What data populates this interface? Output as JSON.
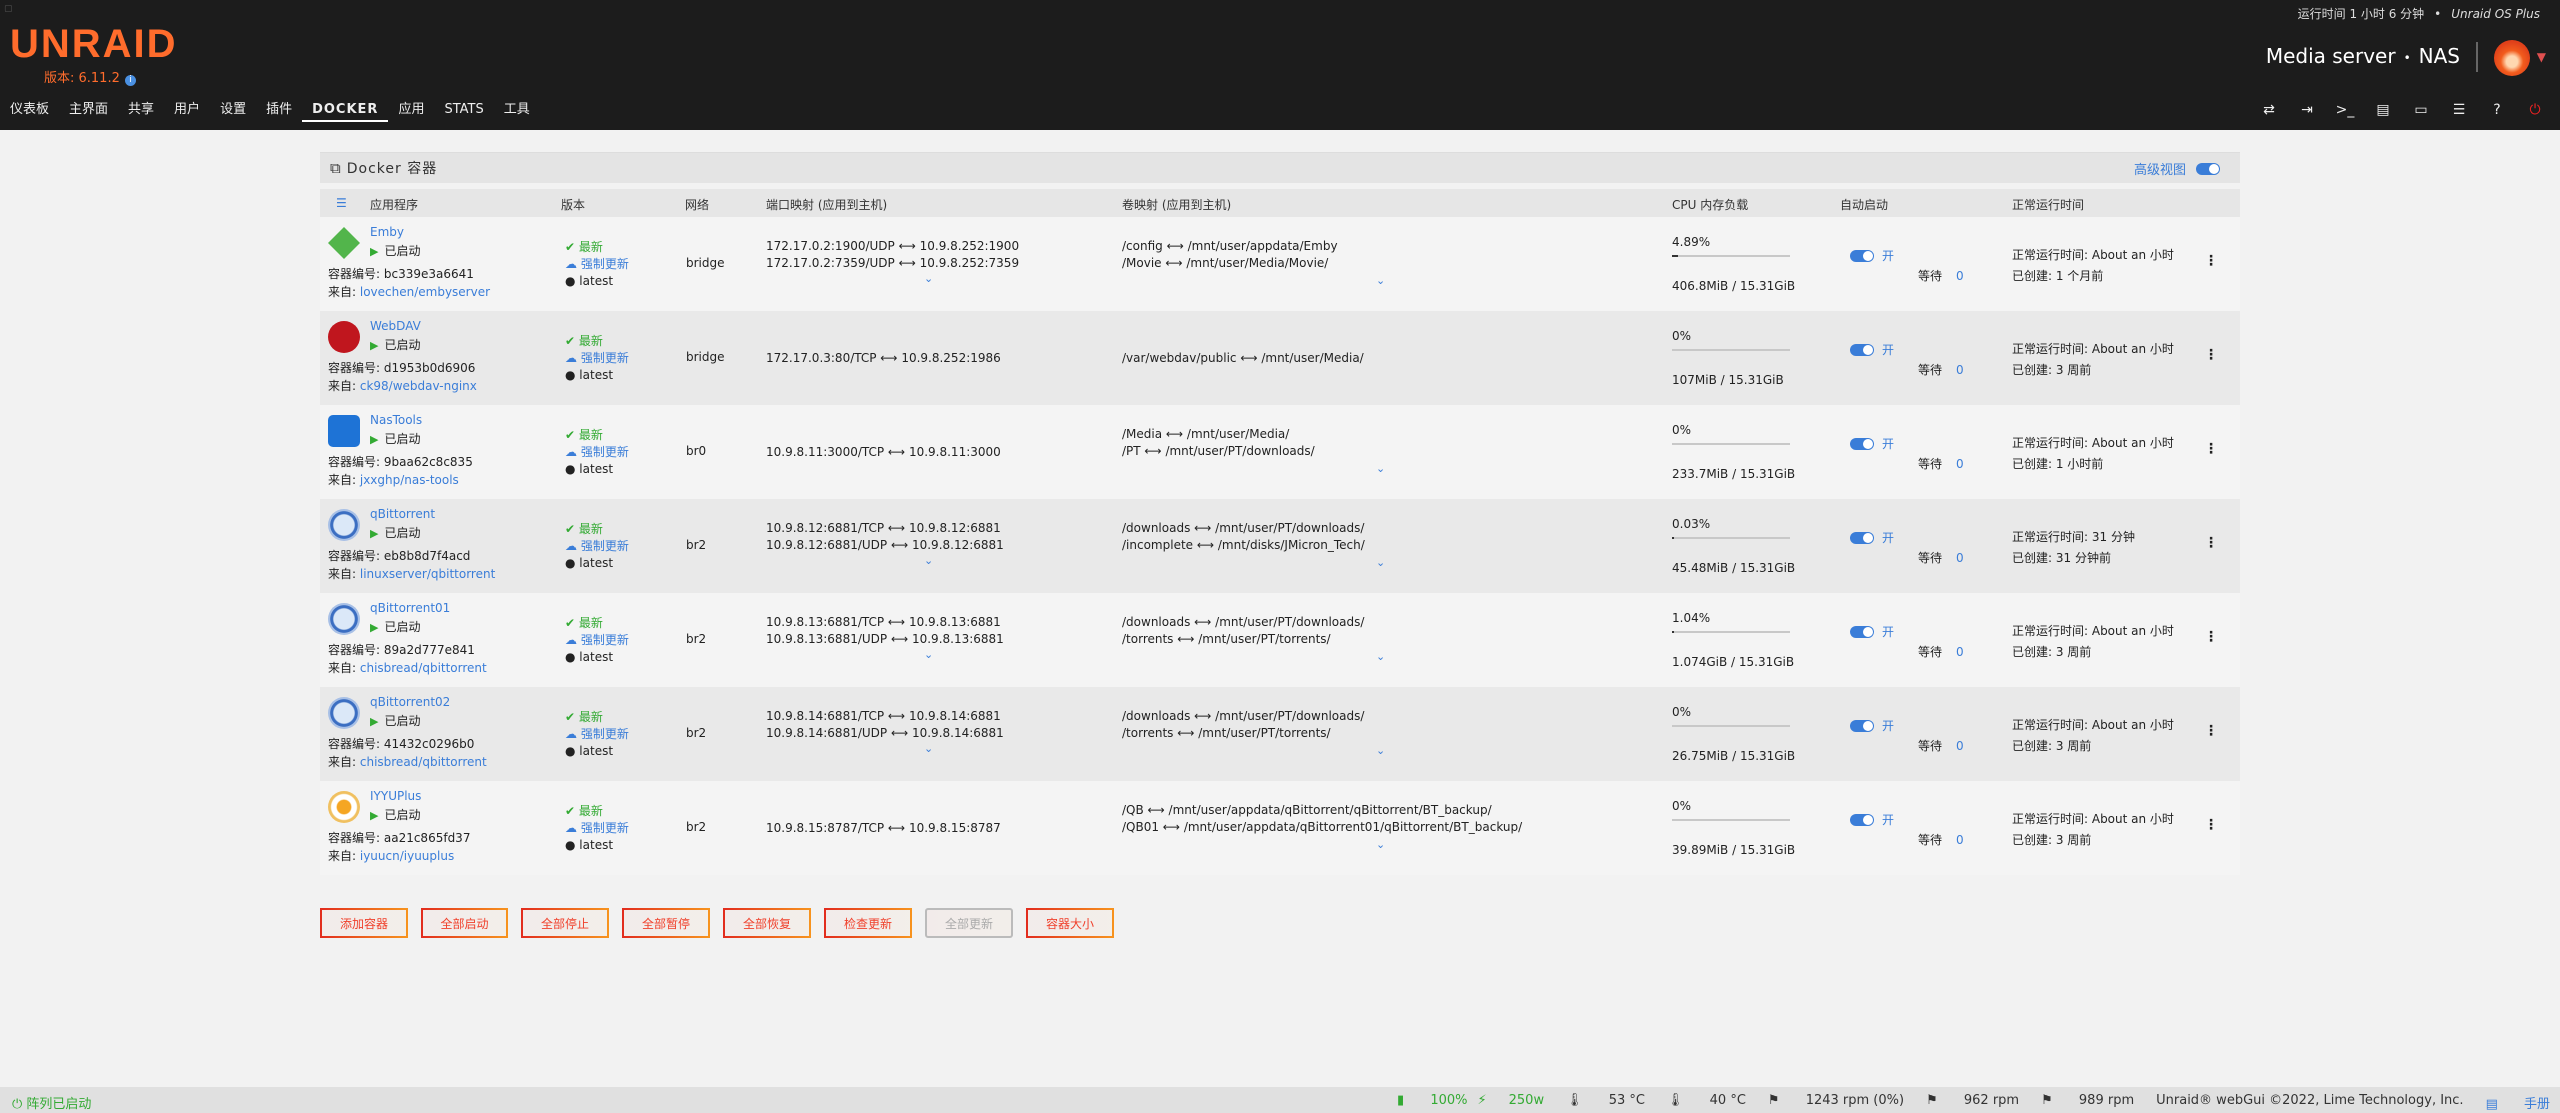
{
  "header": {
    "logo": "UNRAID",
    "version": "版本: 6.11.2",
    "uptime": "运行时间 1 小时 6 分钟",
    "plan": "Unraid OS Plus",
    "server_name": "Media server",
    "server_desc": "NAS"
  },
  "nav": [
    "仪表板",
    "主界面",
    "共享",
    "用户",
    "设置",
    "插件",
    "DOCKER",
    "应用",
    "STATS",
    "工具"
  ],
  "nav_active": "DOCKER",
  "panel": {
    "title": "Docker 容器",
    "advanced_view": "高级视图"
  },
  "columns": {
    "app": "应用程序",
    "version": "版本",
    "network": "网络",
    "ports": "端口映射 (应用到主机)",
    "volumes": "卷映射 (应用到主机)",
    "cpu_mem": "CPU 内存负载",
    "autostart": "自动启动",
    "uptime": "正常运行时间"
  },
  "labels": {
    "started": "已启动",
    "id_prefix": "容器编号: ",
    "source_prefix": "来自: ",
    "latest_ok": "最新",
    "force_update": "强制更新",
    "latest_tag": "latest",
    "on": "开",
    "wait": "等待"
  },
  "containers": [
    {
      "name": "Emby",
      "id": "bc339e3a6641",
      "source": "lovechen/embyserver",
      "network": "bridge",
      "ports": [
        "172.17.0.2:1900/UDP ⟷ 10.9.8.252:1900",
        "172.17.0.2:7359/UDP ⟷ 10.9.8.252:7359"
      ],
      "volumes": [
        "/config ⟷ /mnt/user/appdata/Emby",
        "/Movie ⟷ /mnt/user/Media/Movie/"
      ],
      "cpu": "4.89%",
      "cpu_fraction": 0.0489,
      "mem": "406.8MiB / 15.31GiB",
      "wait": "0",
      "uptime": "正常运行时间: About an 小时",
      "created": "已创建: 1 个月前"
    },
    {
      "name": "WebDAV",
      "id": "d1953b0d6906",
      "source": "ck98/webdav-nginx",
      "network": "bridge",
      "ports": [
        "172.17.0.3:80/TCP ⟷ 10.9.8.252:1986"
      ],
      "volumes": [
        "/var/webdav/public ⟷ /mnt/user/Media/"
      ],
      "cpu": "0%",
      "cpu_fraction": 0,
      "mem": "107MiB / 15.31GiB",
      "wait": "0",
      "uptime": "正常运行时间: About an 小时",
      "created": "已创建: 3 周前"
    },
    {
      "name": "NasTools",
      "id": "9baa62c8c835",
      "source": "jxxghp/nas-tools",
      "network": "br0",
      "ports": [
        "10.9.8.11:3000/TCP ⟷ 10.9.8.11:3000"
      ],
      "volumes": [
        "/Media ⟷ /mnt/user/Media/",
        "/PT ⟷ /mnt/user/PT/downloads/"
      ],
      "cpu": "0%",
      "cpu_fraction": 0,
      "mem": "233.7MiB / 15.31GiB",
      "wait": "0",
      "uptime": "正常运行时间: About an 小时",
      "created": "已创建: 1 小时前"
    },
    {
      "name": "qBittorrent",
      "id": "eb8b8d7f4acd",
      "source": "linuxserver/qbittorrent",
      "network": "br2",
      "ports": [
        "10.9.8.12:6881/TCP ⟷ 10.9.8.12:6881",
        "10.9.8.12:6881/UDP ⟷ 10.9.8.12:6881"
      ],
      "volumes": [
        "/downloads ⟷ /mnt/user/PT/downloads/",
        "/incomplete ⟷ /mnt/disks/JMicron_Tech/"
      ],
      "cpu": "0.03%",
      "cpu_fraction": 0.0003,
      "mem": "45.48MiB / 15.31GiB",
      "wait": "0",
      "uptime": "正常运行时间: 31 分钟",
      "created": "已创建: 31 分钟前"
    },
    {
      "name": "qBittorrent01",
      "id": "89a2d777e841",
      "source": "chisbread/qbittorrent",
      "network": "br2",
      "ports": [
        "10.9.8.13:6881/TCP ⟷ 10.9.8.13:6881",
        "10.9.8.13:6881/UDP ⟷ 10.9.8.13:6881"
      ],
      "volumes": [
        "/downloads ⟷ /mnt/user/PT/downloads/",
        "/torrents ⟷ /mnt/user/PT/torrents/"
      ],
      "cpu": "1.04%",
      "cpu_fraction": 0.0104,
      "mem": "1.074GiB / 15.31GiB",
      "wait": "0",
      "uptime": "正常运行时间: About an 小时",
      "created": "已创建: 3 周前"
    },
    {
      "name": "qBittorrent02",
      "id": "41432c0296b0",
      "source": "chisbread/qbittorrent",
      "network": "br2",
      "ports": [
        "10.9.8.14:6881/TCP ⟷ 10.9.8.14:6881",
        "10.9.8.14:6881/UDP ⟷ 10.9.8.14:6881"
      ],
      "volumes": [
        "/downloads ⟷ /mnt/user/PT/downloads/",
        "/torrents ⟷ /mnt/user/PT/torrents/"
      ],
      "cpu": "0%",
      "cpu_fraction": 0,
      "mem": "26.75MiB / 15.31GiB",
      "wait": "0",
      "uptime": "正常运行时间: About an 小时",
      "created": "已创建: 3 周前"
    },
    {
      "name": "IYYUPlus",
      "id": "aa21c865fd37",
      "source": "iyuucn/iyuuplus",
      "network": "br2",
      "ports": [
        "10.9.8.15:8787/TCP ⟷ 10.9.8.15:8787"
      ],
      "volumes": [
        "/QB ⟷ /mnt/user/appdata/qBittorrent/qBittorrent/BT_backup/",
        "/QB01 ⟷ /mnt/user/appdata/qBittorrent01/qBittorrent/BT_backup/"
      ],
      "cpu": "0%",
      "cpu_fraction": 0,
      "mem": "39.89MiB / 15.31GiB",
      "wait": "0",
      "uptime": "正常运行时间: About an 小时",
      "created": "已创建: 3 周前"
    }
  ],
  "buttons": [
    "添加容器",
    "全部启动",
    "全部停止",
    "全部暂停",
    "全部恢复",
    "检查更新",
    "全部更新",
    "容器大小"
  ],
  "footer": {
    "array_status": "阵列已启动",
    "ups": "100%",
    "power": "250w",
    "temp1": "53 °C",
    "temp2": "40 °C",
    "fan1": "1243 rpm (0%)",
    "fan2": "962 rpm",
    "fan3": "989 rpm",
    "copyright": "Unraid® webGui ©2022, Lime Technology, Inc.",
    "manual": "手册"
  }
}
